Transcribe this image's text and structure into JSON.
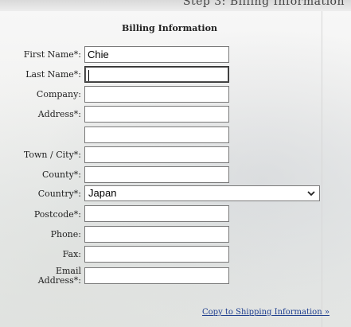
{
  "header": {
    "partial_text": "Step 3: Billing Information"
  },
  "billing": {
    "title": "Billing Information",
    "first_name": {
      "label": "First Name*:",
      "value": "Chie"
    },
    "last_name": {
      "label": "Last Name*:",
      "value": ""
    },
    "company": {
      "label": "Company:",
      "value": ""
    },
    "address": {
      "label": "Address*:",
      "line1": "",
      "line2": ""
    },
    "town_city": {
      "label": "Town / City*:",
      "value": ""
    },
    "county": {
      "label": "County*:",
      "value": ""
    },
    "country": {
      "label": "Country*:",
      "value": "Japan"
    },
    "postcode": {
      "label": "Postcode*:",
      "value": ""
    },
    "phone": {
      "label": "Phone:",
      "value": ""
    },
    "fax": {
      "label": "Fax:",
      "value": ""
    },
    "email": {
      "label_line1": "Email",
      "label_line2": "Address*:",
      "value": ""
    },
    "copy_link": "Copy to Shipping Information »"
  },
  "icons": {
    "country_dropdown": "chevron-down-icon"
  }
}
